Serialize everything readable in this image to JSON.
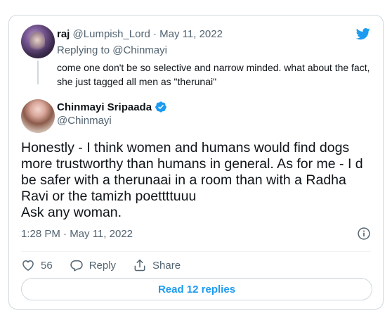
{
  "colors": {
    "accent": "#1d9bf0",
    "secondary_text": "#536471",
    "border": "#cfd9de"
  },
  "replied_tweet": {
    "display_name": "raj",
    "handle": "@Lumpish_Lord",
    "separator": "·",
    "date": "May 11, 2022",
    "replying_prefix": "Replying to",
    "replying_to": "@Chinmayi",
    "text": "come one don't be so selective and narrow minded. what about the fact, she just tagged all men as \"therunai\""
  },
  "main_tweet": {
    "display_name": "Chinmayi Sripaada",
    "handle": "@Chinmayi",
    "verified": true,
    "text": "Honestly - I think women and humans would find dogs more trustworthy than humans in general. As for me - I d be safer with a therunaai in a room than with a Radha Ravi or the tamizh poettttuuu\nAsk any woman.",
    "timestamp": "1:28 PM · May 11, 2022"
  },
  "actions": {
    "like_count": "56",
    "reply_label": "Reply",
    "share_label": "Share"
  },
  "read_replies_label": "Read 12 replies",
  "icons": [
    "twitter-bird-icon",
    "verified-badge-icon",
    "info-icon",
    "heart-icon",
    "reply-icon",
    "share-icon"
  ]
}
